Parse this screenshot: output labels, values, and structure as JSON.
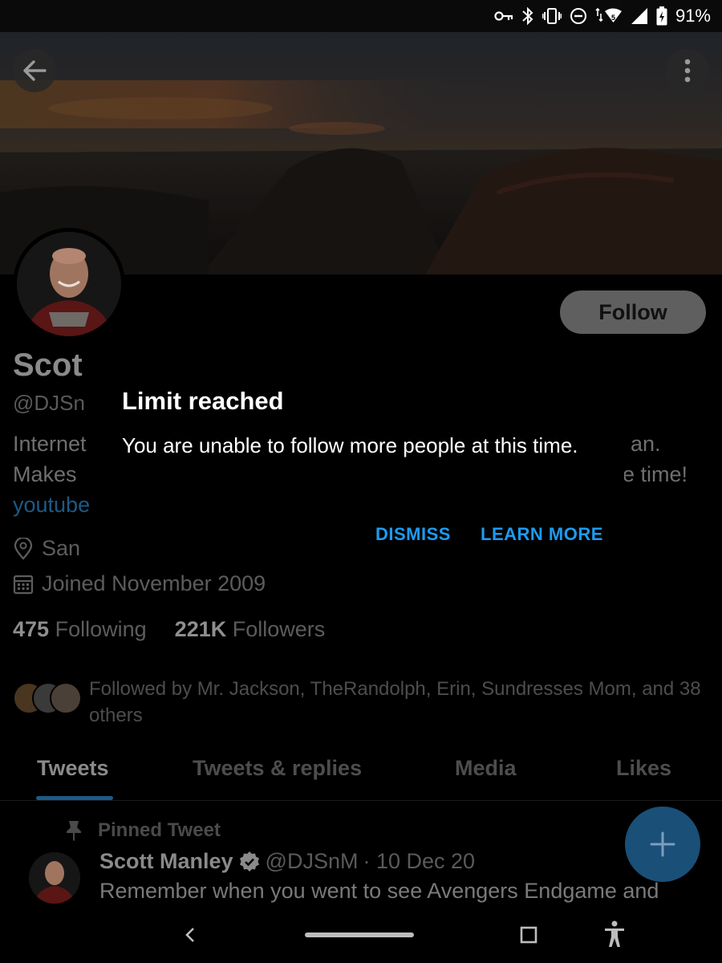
{
  "status_bar": {
    "battery_percent": "91%",
    "icons": [
      "vpn-key-icon",
      "bluetooth-icon",
      "vibrate-icon",
      "do-not-disturb-icon",
      "wifi-icon",
      "cellular-signal-icon",
      "battery-charging-icon"
    ],
    "wifi_badge": "5"
  },
  "header": {
    "back_icon": "arrow-left-icon",
    "more_icon": "more-vertical-icon"
  },
  "profile": {
    "follow_label": "Follow",
    "name_visible": "Scot",
    "name_full": "Scott Manley",
    "handle_visible": "@DJSn",
    "bio_line1_left": "Internet",
    "bio_line1_right": "an.",
    "bio_line2_left": "Makes ",
    "bio_line2_right": "e time!",
    "bio_link_visible": "youtube",
    "location_visible": "San",
    "joined": "Joined November 2009",
    "following_count": "475",
    "following_label": "Following",
    "followers_count": "221K",
    "followers_label": "Followers",
    "followed_by": "Followed by Mr. Jackson, TheRandolph, Erin, Sundresses Mom, and 38 others"
  },
  "tabs": [
    {
      "label": "Tweets",
      "active": true
    },
    {
      "label": "Tweets & replies",
      "active": false
    },
    {
      "label": "Media",
      "active": false
    },
    {
      "label": "Likes",
      "active": false
    }
  ],
  "pinned_tweet": {
    "pinned_label": "Pinned Tweet",
    "author_name": "Scott Manley",
    "author_handle": "@DJSnM",
    "date": "· 10 Dec 20",
    "text": "Remember when you went to see Avengers Endgame and"
  },
  "dialog": {
    "title": "Limit reached",
    "message": "You are unable to follow more people at this time.",
    "dismiss_label": "DISMISS",
    "learn_more_label": "LEARN MORE"
  },
  "colors": {
    "accent": "#1d9bf0",
    "background": "#000000"
  }
}
